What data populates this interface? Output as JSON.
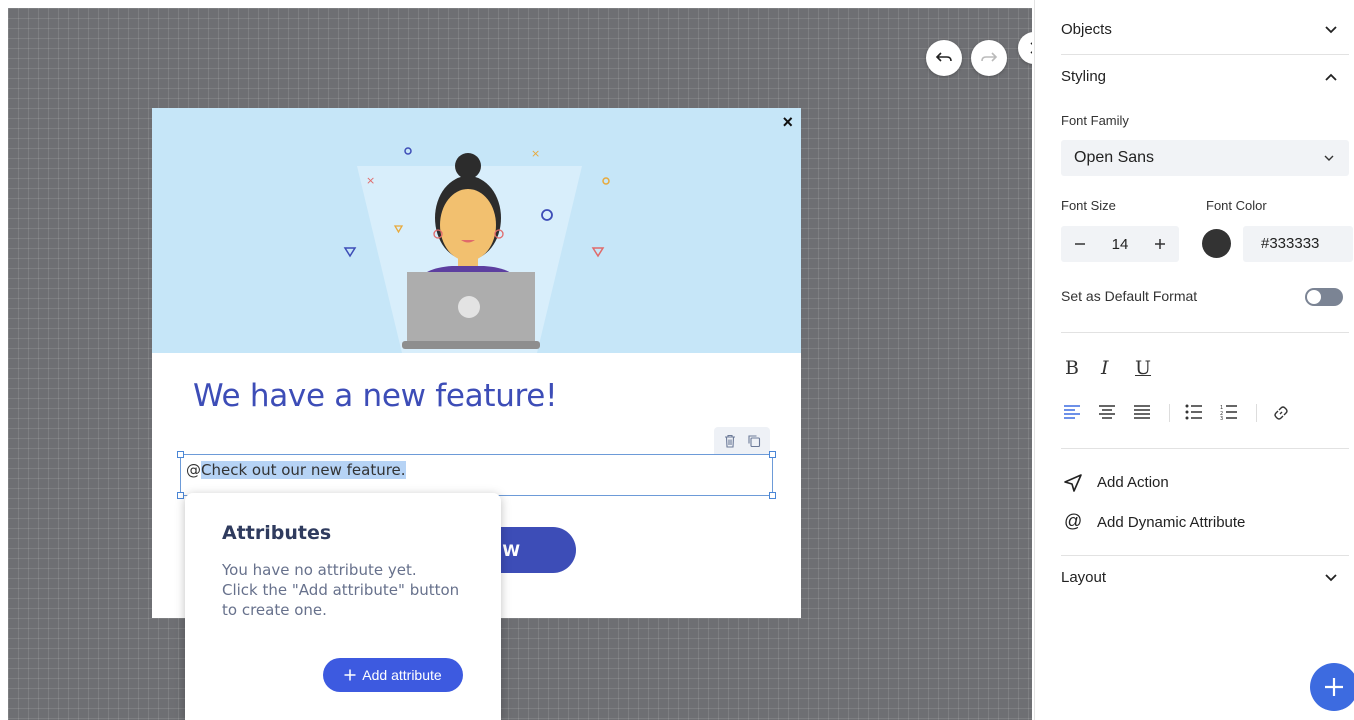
{
  "canvas": {
    "undo_icon": "undo-arrow",
    "redo_icon": "redo-arrow",
    "collapse_icon": "chevron-right"
  },
  "popup": {
    "headline": "We have a new feature!",
    "text_prefix": "@",
    "text_selected": "Check out our new feature.",
    "cta_label": "W",
    "close_label": "×"
  },
  "attributes": {
    "title": "Attributes",
    "line1": "You have no attribute yet.",
    "line2": "Click the \"Add attribute\" button",
    "line3": "to create one.",
    "add_button": "Add attribute"
  },
  "panel": {
    "objects_title": "Objects",
    "styling_title": "Styling",
    "font_family_label": "Font Family",
    "font_family_value": "Open Sans",
    "font_size_label": "Font Size",
    "font_size_value": "14",
    "font_color_label": "Font Color",
    "font_color_value": "#333333",
    "default_format_label": "Set as Default Format",
    "bold": "B",
    "italic": "I",
    "underline": "U",
    "add_action": "Add Action",
    "add_dynamic_attribute": "Add Dynamic Attribute",
    "at_symbol": "@",
    "layout_title": "Layout"
  },
  "colors": {
    "accent": "#3d4db7",
    "hero_bg": "#c6e6f8",
    "selection": "#b6d3f5",
    "fab": "#3d6be0"
  }
}
